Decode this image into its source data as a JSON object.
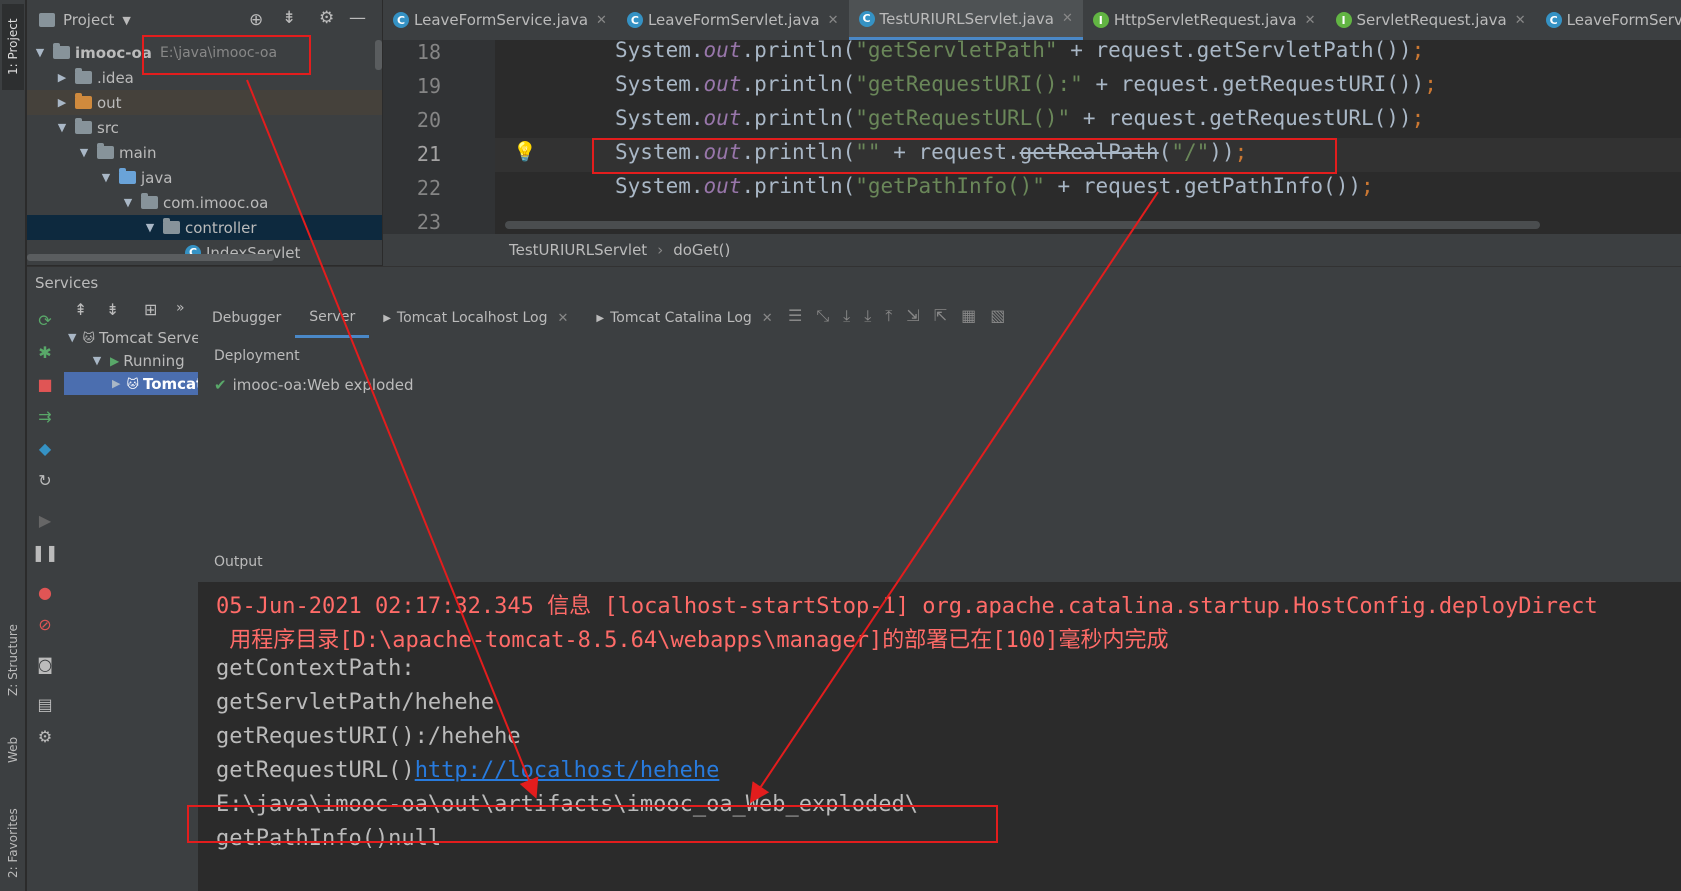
{
  "project_panel": {
    "title": "Project",
    "tree": [
      {
        "label": "imooc-oa",
        "path": "E:\\java\\imooc-oa",
        "depth": 0,
        "expanded": true,
        "icon": "module-folder"
      },
      {
        "label": ".idea",
        "depth": 1,
        "expanded": false,
        "icon": "folder"
      },
      {
        "label": "out",
        "depth": 1,
        "expanded": false,
        "icon": "folder-orange"
      },
      {
        "label": "src",
        "depth": 1,
        "expanded": true,
        "icon": "folder"
      },
      {
        "label": "main",
        "depth": 2,
        "expanded": true,
        "icon": "folder"
      },
      {
        "label": "java",
        "depth": 3,
        "expanded": true,
        "icon": "folder-blue"
      },
      {
        "label": "com.imooc.oa",
        "depth": 4,
        "expanded": true,
        "icon": "package"
      },
      {
        "label": "controller",
        "depth": 5,
        "expanded": true,
        "icon": "package",
        "selected": true
      },
      {
        "label": "IndexServlet",
        "depth": 6,
        "icon": "class"
      }
    ]
  },
  "left_strip": {
    "project_tab": "1: Project",
    "structure_tab": "Z: Structure",
    "web_tab": "Web",
    "favorites_tab": "2: Favorites"
  },
  "editor": {
    "tabs": [
      {
        "label": "LeaveFormService.java",
        "icon": "class"
      },
      {
        "label": "LeaveFormServlet.java",
        "icon": "class"
      },
      {
        "label": "TestURIURLServlet.java",
        "icon": "class",
        "active": true
      },
      {
        "label": "HttpServletRequest.java",
        "icon": "interface"
      },
      {
        "label": "ServletRequest.java",
        "icon": "interface"
      },
      {
        "label": "LeaveFormService",
        "icon": "class"
      }
    ],
    "lines": [
      {
        "num": "18",
        "pre": "System.",
        "out": "out",
        "mid": ".println(",
        "str": "\"getServletPath\"",
        "post": " + request.getServletPath())",
        "semi": ";"
      },
      {
        "num": "19",
        "pre": "System.",
        "out": "out",
        "mid": ".println(",
        "str": "\"getRequestURI():\"",
        "post": " + request.getRequestURI())",
        "semi": ";"
      },
      {
        "num": "20",
        "pre": "System.",
        "out": "out",
        "mid": ".println(",
        "str": "\"getRequestURL()\"",
        "post": " + request.getRequestURL())",
        "semi": ";"
      },
      {
        "num": "21",
        "pre": "System.",
        "out": "out",
        "mid": ".println(",
        "str": "\"\"",
        "post1": " + request.",
        "deprecated": "getRealPath",
        "post2": "(",
        "str2": "\"/\"",
        "post3": "))",
        "semi": ";"
      },
      {
        "num": "22",
        "pre": "System.",
        "out": "out",
        "mid": ".println(",
        "str": "\"getPathInfo()\"",
        "post": " + request.getPathInfo())",
        "semi": ";"
      },
      {
        "num": "23"
      }
    ],
    "breadcrumb": [
      "TestURIURLServlet",
      "doGet()"
    ]
  },
  "services": {
    "title": "Services",
    "tree": [
      {
        "label": "Tomcat Server",
        "depth": 0,
        "expanded": true
      },
      {
        "label": "Running",
        "depth": 1,
        "expanded": true
      },
      {
        "label": "Tomcat",
        "depth": 2,
        "selected": true
      }
    ],
    "tabs": [
      {
        "label": "Debugger"
      },
      {
        "label": "Server",
        "active": true
      },
      {
        "label": "Tomcat Localhost Log"
      },
      {
        "label": "Tomcat Catalina Log"
      }
    ],
    "deployment_label": "Deployment",
    "deployment_item": "imooc-oa:Web exploded",
    "output_label": "Output",
    "output_lines": [
      {
        "text": "05-Jun-2021 02:17:32.345 信息 [localhost-startStop-1] org.apache.catalina.startup.HostConfig.deployDirect",
        "style": "red"
      },
      {
        "text": " 用程序目录[D:\\apache-tomcat-8.5.64\\webapps\\manager]的部署已在[100]毫秒内完成",
        "style": "red"
      },
      {
        "text": "getContextPath:",
        "style": "normal"
      },
      {
        "text": "getServletPath/hehehe",
        "style": "normal"
      },
      {
        "text": "getRequestURI():/hehehe",
        "style": "normal"
      },
      {
        "text": "getRequestURL()",
        "link": "http://localhost/hehehe",
        "style": "normal"
      },
      {
        "text": "E:\\java\\imooc-oa\\out\\artifacts\\imooc_oa_Web_exploded\\",
        "style": "normal"
      },
      {
        "text": "getPathInfo()null",
        "style": "normal"
      }
    ]
  },
  "colors": {
    "annotation_red": "#e31d1d",
    "selection_blue": "#4b6eaf",
    "tree_selected": "#0d293e"
  }
}
